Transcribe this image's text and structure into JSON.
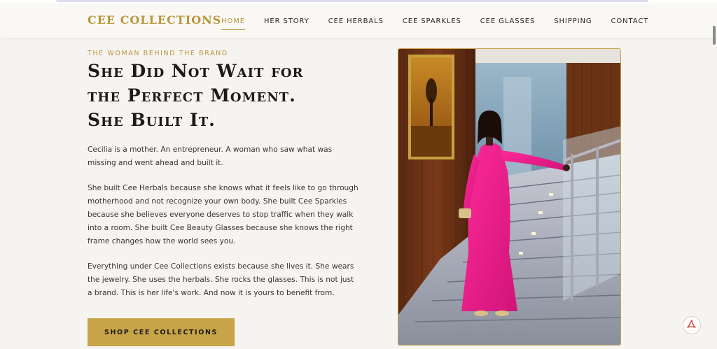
{
  "header": {
    "brand": "CEE COLLECTIONS",
    "nav": [
      {
        "label": "HOME",
        "active": true
      },
      {
        "label": "HER STORY",
        "active": false
      },
      {
        "label": "CEE HERBALS",
        "active": false
      },
      {
        "label": "CEE SPARKLES",
        "active": false
      },
      {
        "label": "CEE GLASSES",
        "active": false
      },
      {
        "label": "SHIPPING",
        "active": false
      },
      {
        "label": "CONTACT",
        "active": false
      }
    ]
  },
  "hero": {
    "eyebrow": "THE WOMAN BEHIND THE BRAND",
    "headline_lines": [
      "She Did Not Wait for",
      "the Perfect Moment.",
      "She Built It."
    ],
    "paragraphs": [
      "Cecilia is a mother. An entrepreneur. A woman who saw what was missing and went ahead and built it.",
      "She built Cee Herbals because she knows what it feels like to go through motherhood and not recognize your own body. She built Cee Sparkles because she believes everyone deserves to stop traffic when they walk into a room. She built Cee Beauty Glasses because she knows the right frame changes how the world sees you.",
      "Everything under Cee Collections exists because she lives it. She wears the jewelry. She uses the herbals. She rocks the glasses. This is not just a brand. This is her life's work. And now it is yours to benefit from."
    ],
    "cta_label": "SHOP CEE COLLECTIONS"
  },
  "icons": {
    "pdf": "pdf-icon"
  },
  "colors": {
    "gold": "#b8963a",
    "button_gold": "#c7a448",
    "background": "#f6f4f1",
    "dress_pink": "#e8198a"
  }
}
